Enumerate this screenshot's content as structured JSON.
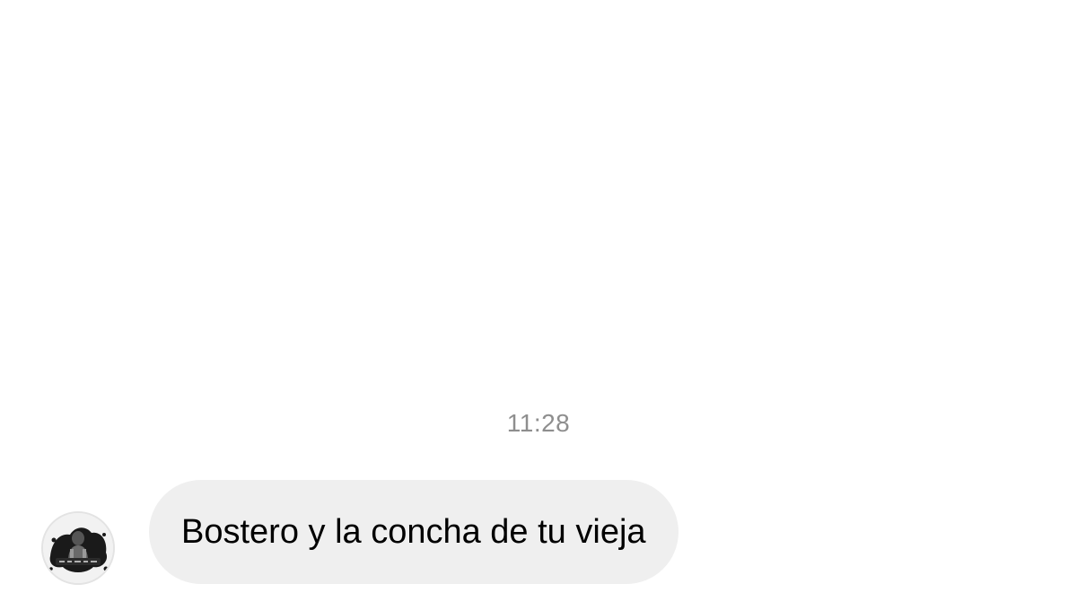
{
  "conversation": {
    "timestamp": "11:28",
    "messages": [
      {
        "sender_avatar_icon": "profile-photo-icon",
        "text": "Bostero y la concha de tu vieja"
      }
    ]
  },
  "colors": {
    "background": "#ffffff",
    "bubble_received": "#efefef",
    "timestamp_text": "#8e8e8e",
    "message_text": "#000000"
  }
}
